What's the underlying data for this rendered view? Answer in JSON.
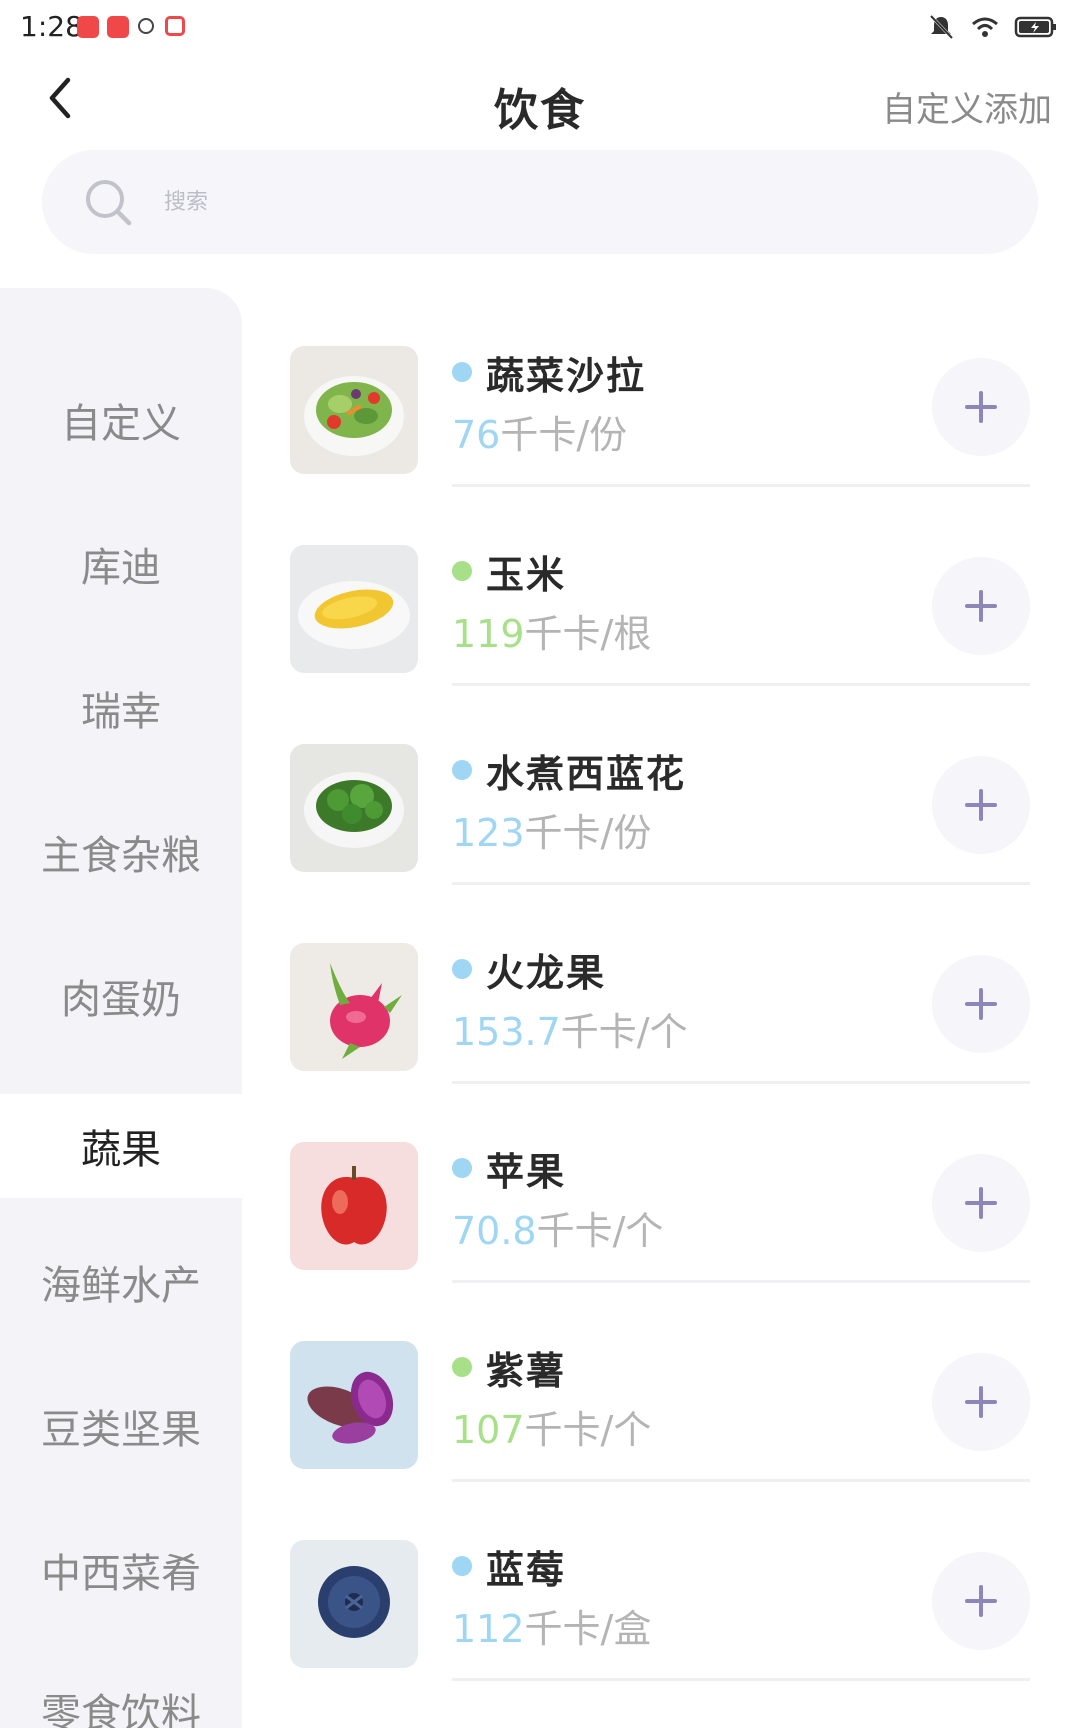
{
  "status_bar": {
    "time": "1:28"
  },
  "header": {
    "title": "饮食",
    "custom_add_label": "自定义添加"
  },
  "search": {
    "placeholder": "搜索"
  },
  "sidebar": {
    "items": [
      {
        "label": "自定义",
        "active": false
      },
      {
        "label": "库迪",
        "active": false
      },
      {
        "label": "瑞幸",
        "active": false
      },
      {
        "label": "主食杂粮",
        "active": false
      },
      {
        "label": "肉蛋奶",
        "active": false
      },
      {
        "label": "蔬果",
        "active": true
      },
      {
        "label": "海鲜水产",
        "active": false
      },
      {
        "label": "豆类坚果",
        "active": false
      },
      {
        "label": "中西菜肴",
        "active": false
      },
      {
        "label": "零食饮料",
        "active": false
      }
    ]
  },
  "colors": {
    "dot_blue": "#9ed6f4",
    "dot_green": "#a8e08a",
    "accent_purple": "#8d86b8"
  },
  "foods": [
    {
      "name": "蔬菜沙拉",
      "calories": "76",
      "unit": "千卡/份",
      "dot": "blue",
      "image": "salad-image"
    },
    {
      "name": "玉米",
      "calories": "119",
      "unit": "千卡/根",
      "dot": "green",
      "image": "corn-image"
    },
    {
      "name": "水煮西蓝花",
      "calories": "123",
      "unit": "千卡/份",
      "dot": "blue",
      "image": "broccoli-image"
    },
    {
      "name": "火龙果",
      "calories": "153.7",
      "unit": "千卡/个",
      "dot": "blue",
      "image": "dragonfruit-image"
    },
    {
      "name": "苹果",
      "calories": "70.8",
      "unit": "千卡/个",
      "dot": "blue",
      "image": "apple-image"
    },
    {
      "name": "紫薯",
      "calories": "107",
      "unit": "千卡/个",
      "dot": "green",
      "image": "purple-sweet-potato-image"
    },
    {
      "name": "蓝莓",
      "calories": "112",
      "unit": "千卡/盒",
      "dot": "blue",
      "image": "blueberry-image"
    }
  ]
}
